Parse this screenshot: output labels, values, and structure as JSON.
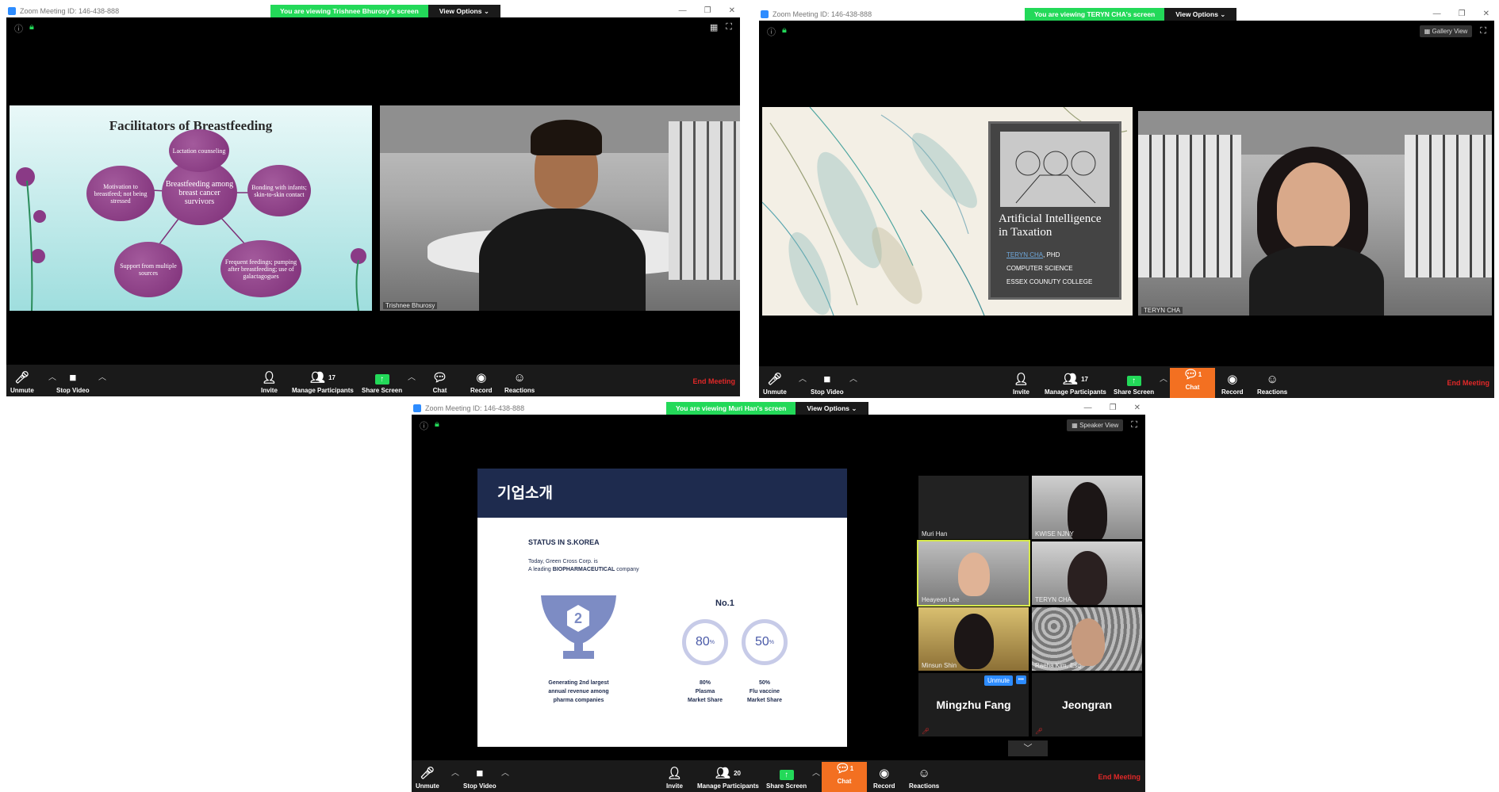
{
  "w1": {
    "title": "Zoom Meeting ID: 146-438-888",
    "banner": "You are viewing Trishnee Bhurosy's screen",
    "view_options": "View Options ⌄",
    "slide": {
      "title": "Facilitators of Breastfeeding",
      "center": "Breastfeeding among breast cancer survivors",
      "b1": "Lactation counseling",
      "b2": "Bonding with infants; skin-to-skin contact",
      "b3": "Frequent feedings; pumping after breastfeeding; use of galactagogues",
      "b4": "Support from multiple sources",
      "b5": "Motivation to breastfeed; not being stressed"
    },
    "speaker": "Trishnee Bhurosy",
    "toolbar": {
      "unmute": "Unmute",
      "stop_video": "Stop Video",
      "invite": "Invite",
      "manage": "Manage Participants",
      "count": "17",
      "share": "Share Screen",
      "chat": "Chat",
      "record": "Record",
      "reactions": "Reactions",
      "end": "End Meeting"
    }
  },
  "w2": {
    "title": "Zoom Meeting ID: 146-438-888",
    "banner": "You are viewing TERYN CHA's screen",
    "view_options": "View Options ⌄",
    "gallery": "Gallery View",
    "slide": {
      "line1": "Artificial Intelligence",
      "line2": "in Taxation",
      "name": "TERYN CHA",
      "deg": ", PHD",
      "dept": "COMPUTER SCIENCE",
      "college": "ESSEX COUNUTY COLLEGE"
    },
    "speaker": "TERYN CHA",
    "toolbar": {
      "unmute": "Unmute",
      "stop_video": "Stop Video",
      "invite": "Invite",
      "manage": "Manage Participants",
      "count": "17",
      "share": "Share Screen",
      "chat": "Chat",
      "chat_count": "1",
      "record": "Record",
      "reactions": "Reactions",
      "end": "End Meeting"
    }
  },
  "w3": {
    "title": "Zoom Meeting ID: 146-438-888",
    "banner": "You are viewing Muri Han's screen",
    "view_options": "View Options ⌄",
    "speaker_view": "Speaker View",
    "slide": {
      "heading": "기업소개",
      "status": "STATUS IN S.KOREA",
      "intro1": "Today, Green Cross Corp. is",
      "intro2a": "A leading ",
      "intro2b": "BIOPHARMACEUTICAL",
      "intro2c": " company",
      "rank": "2",
      "trophy_cap1": "Generating 2nd largest",
      "trophy_cap2": "annual revenue among",
      "trophy_cap3": "pharma companies",
      "no1": "No.1",
      "p1": "80",
      "p2": "50",
      "pct": "%",
      "c1a": "80%",
      "c1b": "Plasma",
      "c1c": "Market Share",
      "c2a": "50%",
      "c2b": "Flu vaccine",
      "c2c": "Market Share"
    },
    "participants": [
      "Muri Han",
      "KWISE NJNY",
      "Heayeon Lee",
      "TERYN CHA",
      "Minsun Shin",
      "Raeha Kim, Esq",
      "Mingzhu Fang",
      "Jeongran"
    ],
    "unmute_btn": "Unmute",
    "more_btn": "•••",
    "toolbar": {
      "unmute": "Unmute",
      "stop_video": "Stop Video",
      "invite": "Invite",
      "manage": "Manage Participants",
      "count": "20",
      "share": "Share Screen",
      "chat": "Chat",
      "chat_count": "1",
      "record": "Record",
      "reactions": "Reactions",
      "end": "End Meeting"
    }
  }
}
